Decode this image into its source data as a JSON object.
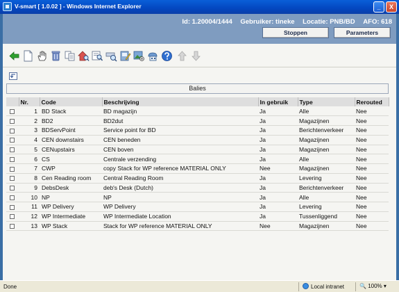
{
  "window": {
    "title": "V-smart [ 1.0.02 ] - Windows Internet Explorer",
    "minimize": "_",
    "close": "X"
  },
  "header": {
    "id_text": "Id: 1.20004/1444",
    "user_text": "Gebruiker: tineke",
    "location_text": "Locatie: PNB/BD",
    "afo_text": "AFO: 618",
    "stop_label": "Stoppen",
    "params_label": "Parameters"
  },
  "toolbar": {
    "icons": [
      "back-arrow-icon",
      "new-document-icon",
      "hand-select-icon",
      "delete-trash-icon",
      "copy-icon",
      "house-search-icon",
      "search-details-icon",
      "binoculars-icon",
      "edit-document-icon",
      "image-settings-icon",
      "network-icon",
      "help-icon",
      "up-arrow-icon",
      "down-arrow-icon"
    ]
  },
  "table": {
    "caption": "Balies",
    "headers": {
      "nr": "Nr.",
      "code": "Code",
      "beschrijving": "Beschrijving",
      "in_gebruik": "In gebruik",
      "type": "Type",
      "rerouted": "Rerouted"
    },
    "rows": [
      {
        "nr": "1",
        "code": "BD Stack",
        "beschrijving": "BD magazijn",
        "in_gebruik": "Ja",
        "type": "Alle",
        "rerouted": "Nee"
      },
      {
        "nr": "2",
        "code": "BD2",
        "beschrijving": "BD2dut",
        "in_gebruik": "Ja",
        "type": "Magazijnen",
        "rerouted": "Nee"
      },
      {
        "nr": "3",
        "code": "BDServPoint",
        "beschrijving": "Service point for BD",
        "in_gebruik": "Ja",
        "type": "Berichtenverkeer",
        "rerouted": "Nee"
      },
      {
        "nr": "4",
        "code": "CEN downstairs",
        "beschrijving": "CEN beneden",
        "in_gebruik": "Ja",
        "type": "Magazijnen",
        "rerouted": "Nee"
      },
      {
        "nr": "5",
        "code": "CENupstairs",
        "beschrijving": "CEN boven",
        "in_gebruik": "Ja",
        "type": "Magazijnen",
        "rerouted": "Nee"
      },
      {
        "nr": "6",
        "code": "CS",
        "beschrijving": "Centrale verzending",
        "in_gebruik": "Ja",
        "type": "Alle",
        "rerouted": "Nee"
      },
      {
        "nr": "7",
        "code": "CWP",
        "beschrijving": "copy Stack for WP reference MATERIAL ONLY",
        "in_gebruik": "Nee",
        "type": "Magazijnen",
        "rerouted": "Nee"
      },
      {
        "nr": "8",
        "code": "Cen Reading room",
        "beschrijving": "Central Reading Room",
        "in_gebruik": "Ja",
        "type": "Levering",
        "rerouted": "Nee"
      },
      {
        "nr": "9",
        "code": "DebsDesk",
        "beschrijving": "deb's Desk (Dutch)",
        "in_gebruik": "Ja",
        "type": "Berichtenverkeer",
        "rerouted": "Nee"
      },
      {
        "nr": "10",
        "code": "NP",
        "beschrijving": "NP",
        "in_gebruik": "Ja",
        "type": "Alle",
        "rerouted": "Nee"
      },
      {
        "nr": "11",
        "code": "WP Delivery",
        "beschrijving": "WP Delivery",
        "in_gebruik": "Ja",
        "type": "Levering",
        "rerouted": "Nee"
      },
      {
        "nr": "12",
        "code": "WP Intermediate",
        "beschrijving": "WP Intermediate Location",
        "in_gebruik": "Ja",
        "type": "Tussenliggend",
        "rerouted": "Nee"
      },
      {
        "nr": "13",
        "code": "WP Stack",
        "beschrijving": "Stack for WP reference MATERIAL ONLY",
        "in_gebruik": "Nee",
        "type": "Magazijnen",
        "rerouted": "Nee"
      }
    ]
  },
  "statusbar": {
    "status": "Done",
    "zone": "Local intranet",
    "zoom": "100%"
  }
}
